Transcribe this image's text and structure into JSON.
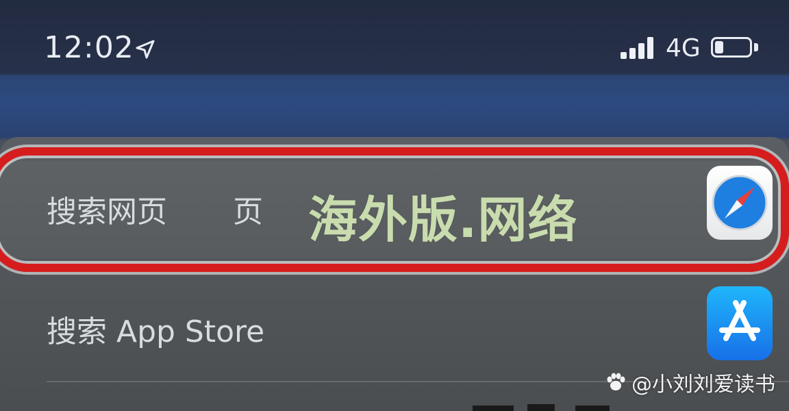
{
  "status_bar": {
    "time": "12:02",
    "network": "4G",
    "signal_bars": 4,
    "battery_level": 0.25,
    "icons": [
      "location-arrow-icon",
      "signal-icon",
      "battery-icon"
    ]
  },
  "results": [
    {
      "label": "搜索网页",
      "label_extra": "页",
      "icon": "safari-icon",
      "highlighted": true
    },
    {
      "label": "搜索 App Store",
      "icon": "app-store-icon",
      "highlighted": false
    }
  ],
  "overlay": {
    "watermark": "海外版.网络"
  },
  "credit": {
    "text": "@小刘刘爱读书",
    "icon": "paw-icon"
  },
  "colors": {
    "highlight_border": "#d61d1d",
    "watermark": "#c9dcae",
    "app_store_blue": "#1a8ff2"
  }
}
